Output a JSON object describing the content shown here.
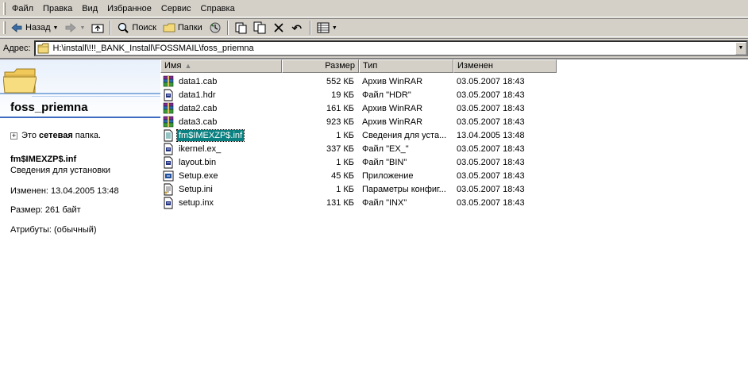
{
  "menu": [
    "Файл",
    "Правка",
    "Вид",
    "Избранное",
    "Сервис",
    "Справка"
  ],
  "toolbar": {
    "back_label": "Назад",
    "search_label": "Поиск",
    "folders_label": "Папки"
  },
  "address": {
    "label": "Адрес:",
    "path": "H:\\install\\!!!_BANK_Install\\FOSSMAIL\\foss_priemna"
  },
  "info": {
    "folder_title": "foss_priemna",
    "net_text_pre": "Это ",
    "net_text_bold": "сетевая",
    "net_text_post": " папка.",
    "selected_name": "fm$IMEXZP$.inf",
    "selected_type": "Сведения для установки",
    "modified": "Изменен: 13.04.2005 13:48",
    "size": "Размер: 261 байт",
    "attributes": "Атрибуты: (обычный)"
  },
  "columns": {
    "name": "Имя",
    "size": "Размер",
    "type": "Тип",
    "modified": "Изменен"
  },
  "files": [
    {
      "name": "data1.cab",
      "size": "552 КБ",
      "type": "Архив WinRAR",
      "date": "03.05.2007 18:43",
      "icon": "winrar-icon",
      "selected": false
    },
    {
      "name": "data1.hdr",
      "size": "19 КБ",
      "type": "Файл \"HDR\"",
      "date": "03.05.2007 18:43",
      "icon": "file-icon",
      "selected": false
    },
    {
      "name": "data2.cab",
      "size": "161 КБ",
      "type": "Архив WinRAR",
      "date": "03.05.2007 18:43",
      "icon": "winrar-icon",
      "selected": false
    },
    {
      "name": "data3.cab",
      "size": "923 КБ",
      "type": "Архив WinRAR",
      "date": "03.05.2007 18:43",
      "icon": "winrar-icon",
      "selected": false
    },
    {
      "name": "fm$IMEXZP$.inf",
      "size": "1 КБ",
      "type": "Сведения для уста...",
      "date": "13.04.2005 13:48",
      "icon": "inf-icon",
      "selected": true
    },
    {
      "name": "ikernel.ex_",
      "size": "337 КБ",
      "type": "Файл \"EX_\"",
      "date": "03.05.2007 18:43",
      "icon": "file-icon",
      "selected": false
    },
    {
      "name": "layout.bin",
      "size": "1 КБ",
      "type": "Файл \"BIN\"",
      "date": "03.05.2007 18:43",
      "icon": "file-icon",
      "selected": false
    },
    {
      "name": "Setup.exe",
      "size": "45 КБ",
      "type": "Приложение",
      "date": "03.05.2007 18:43",
      "icon": "setup-exe-icon",
      "selected": false
    },
    {
      "name": "Setup.ini",
      "size": "1 КБ",
      "type": "Параметры конфиг...",
      "date": "03.05.2007 18:43",
      "icon": "ini-icon",
      "selected": false
    },
    {
      "name": "setup.inx",
      "size": "131 КБ",
      "type": "Файл \"INX\"",
      "date": "03.05.2007 18:43",
      "icon": "file-icon",
      "selected": false
    }
  ],
  "colors": {
    "window_bg": "#d4d0c8",
    "selection": "#0a8080",
    "title_rule": "#3e6cc0"
  }
}
